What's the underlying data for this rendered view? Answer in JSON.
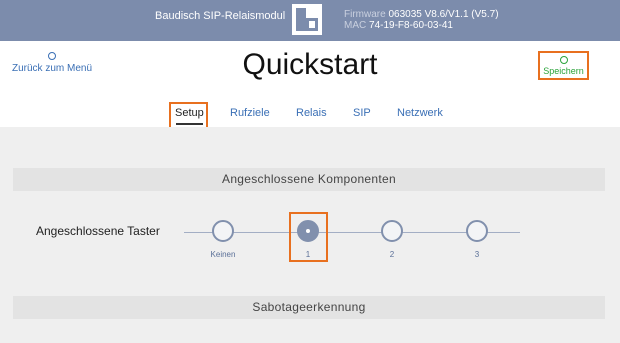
{
  "header": {
    "device_name": "Baudisch SIP-Relaismodul",
    "firmware_label": "Firmware",
    "firmware_value": "063035 V8.6/V1.1 (V5.7)",
    "mac_label": "MAC",
    "mac_value": "74-19-F8-60-03-41"
  },
  "nav": {
    "back_label": "Zurück zum Menü",
    "save_label": "Speichern"
  },
  "page_title": "Quickstart",
  "tabs": [
    {
      "label": "Setup",
      "active": true
    },
    {
      "label": "Rufziele"
    },
    {
      "label": "Relais"
    },
    {
      "label": "SIP"
    },
    {
      "label": "Netzwerk"
    }
  ],
  "sections": {
    "components_title": "Angeschlossene Komponenten",
    "tamper_title": "Sabotageerkennung"
  },
  "buttons_selector": {
    "label": "Angeschlossene Taster",
    "options": [
      "Keinen",
      "1",
      "2",
      "3"
    ],
    "selected": "1"
  },
  "colors": {
    "header_bg": "#7c8cac",
    "accent": "#e8701f",
    "link": "#3a6fb5",
    "save": "#2aa33a"
  }
}
